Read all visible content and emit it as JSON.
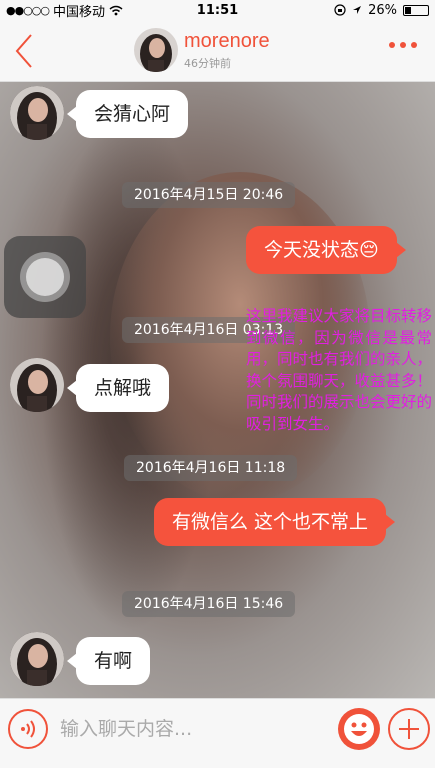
{
  "status_bar": {
    "signal": "●●○○○",
    "carrier": "中国移动",
    "time": "11:51",
    "battery": "26%",
    "battery_level": 0.26
  },
  "header": {
    "contact_name": "morenore",
    "last_seen": "46分钟前"
  },
  "messages": [
    {
      "side": "left",
      "text": "会猜心阿"
    },
    {
      "type": "timestamp",
      "text": "2016年4月15日 20:46"
    },
    {
      "side": "right",
      "text": "今天没状态😔"
    },
    {
      "type": "timestamp",
      "text": "2016年4月16日 03:13"
    },
    {
      "side": "left",
      "text": "点解哦"
    },
    {
      "type": "timestamp",
      "text": "2016年4月16日 11:18"
    },
    {
      "side": "right",
      "text": "有微信么  这个也不常上"
    },
    {
      "type": "timestamp",
      "text": "2016年4月16日 15:46"
    },
    {
      "side": "left",
      "text": "有啊"
    }
  ],
  "annotation": "这里我建议大家将目标转移到微信，因为微信是最常用，同时也有我们的亲人，换个氛围聊天，收益甚多！同时我们的展示也会更好的吸引到女生。",
  "input_bar": {
    "placeholder": "输入聊天内容..."
  },
  "colors": {
    "accent": "#f0523a",
    "bubble_out": "#f5533d",
    "annotation": "#e11fe1"
  },
  "icons": [
    "back-icon",
    "more-icon",
    "voice-icon",
    "emoji-icon",
    "plus-icon",
    "wifi-icon",
    "location-icon",
    "lock-rotation-icon"
  ]
}
